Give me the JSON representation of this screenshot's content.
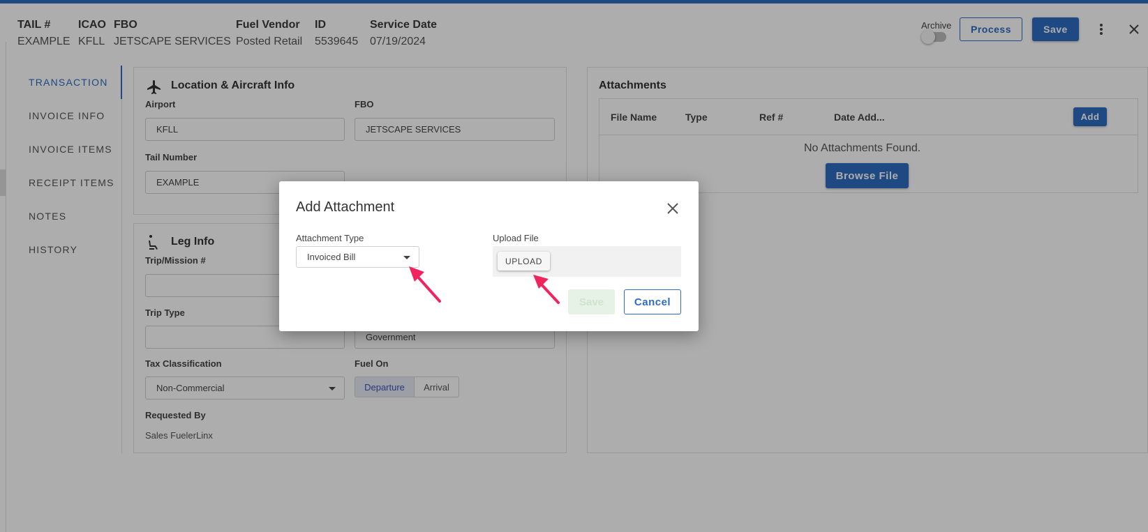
{
  "header": {
    "fields": [
      {
        "label": "TAIL #",
        "value": "EXAMPLE"
      },
      {
        "label": "ICAO",
        "value": "KFLL"
      },
      {
        "label": "FBO",
        "value": "JETSCAPE SERVICES"
      },
      {
        "label": "Fuel Vendor",
        "value": "Posted Retail"
      },
      {
        "label": "ID",
        "value": "5539645"
      },
      {
        "label": "Service Date",
        "value": "07/19/2024"
      }
    ],
    "archive_label": "Archive",
    "archive_on": false,
    "process_label": "Process",
    "save_label": "Save",
    "more_icon": "more-vert-icon",
    "close_icon": "close-icon"
  },
  "nav": {
    "items": [
      {
        "label": "TRANSACTION",
        "active": true
      },
      {
        "label": "INVOICE INFO"
      },
      {
        "label": "INVOICE ITEMS"
      },
      {
        "label": "RECEIPT ITEMS"
      },
      {
        "label": "NOTES"
      },
      {
        "label": "HISTORY"
      }
    ]
  },
  "location": {
    "title": "Location & Aircraft Info",
    "icon": "airplane-icon",
    "airport_label": "Airport",
    "airport_value": "KFLL",
    "fbo_label": "FBO",
    "fbo_value": "JETSCAPE SERVICES",
    "tail_label": "Tail Number",
    "tail_value": "EXAMPLE"
  },
  "leg": {
    "title": "Leg Info",
    "icon": "seat-icon",
    "trip_label": "Trip/Mission #",
    "trip_value": "",
    "trip_type_label": "Trip Type",
    "trip_type_value": "",
    "flight_type_value": "Government",
    "tax_label": "Tax Classification",
    "tax_value": "Non-Commercial",
    "fuel_on_label": "Fuel On",
    "fuel_on_options": [
      "Departure",
      "Arrival"
    ],
    "fuel_on_selected": "Departure",
    "requested_label": "Requested By",
    "requested_value": "Sales FuelerLinx"
  },
  "attachments": {
    "title": "Attachments",
    "columns": [
      "File Name",
      "Type",
      "Ref #",
      "Date Add..."
    ],
    "add_label": "Add",
    "empty_message": "No Attachments Found.",
    "browse_label": "Browse File"
  },
  "modal": {
    "title": "Add Attachment",
    "attachment_type_label": "Attachment Type",
    "attachment_type_value": "Invoiced Bill",
    "upload_file_label": "Upload File",
    "upload_button": "UPLOAD",
    "save_label": "Save",
    "cancel_label": "Cancel",
    "arrow_color": "#f0245f"
  },
  "colors": {
    "accent": "#2d6cc0",
    "annotation": "#f0245f"
  }
}
